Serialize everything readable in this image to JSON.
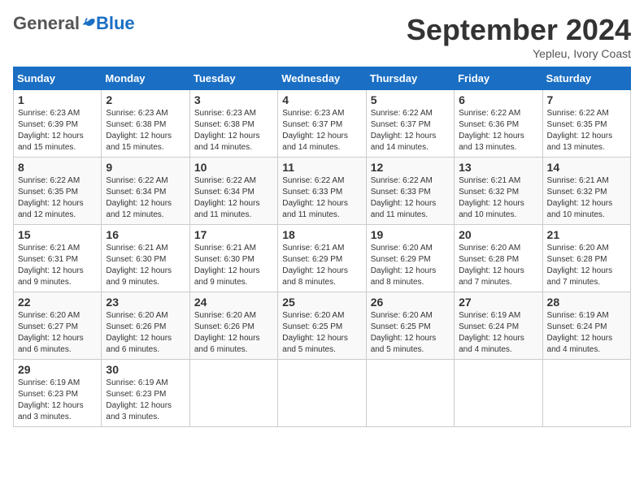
{
  "header": {
    "logo_general": "General",
    "logo_blue": "Blue",
    "month_title": "September 2024",
    "location": "Yepleu, Ivory Coast"
  },
  "calendar": {
    "days_of_week": [
      "Sunday",
      "Monday",
      "Tuesday",
      "Wednesday",
      "Thursday",
      "Friday",
      "Saturday"
    ],
    "weeks": [
      [
        {
          "day": "",
          "sunrise": "",
          "sunset": "",
          "daylight": ""
        },
        {
          "day": "",
          "sunrise": "",
          "sunset": "",
          "daylight": ""
        },
        {
          "day": "",
          "sunrise": "",
          "sunset": "",
          "daylight": ""
        },
        {
          "day": "",
          "sunrise": "",
          "sunset": "",
          "daylight": ""
        },
        {
          "day": "",
          "sunrise": "",
          "sunset": "",
          "daylight": ""
        },
        {
          "day": "",
          "sunrise": "",
          "sunset": "",
          "daylight": ""
        },
        {
          "day": "",
          "sunrise": "",
          "sunset": "",
          "daylight": ""
        }
      ],
      [
        {
          "day": "1",
          "sunrise": "6:23 AM",
          "sunset": "6:39 PM",
          "daylight": "12 hours and 15 minutes."
        },
        {
          "day": "2",
          "sunrise": "6:23 AM",
          "sunset": "6:38 PM",
          "daylight": "12 hours and 15 minutes."
        },
        {
          "day": "3",
          "sunrise": "6:23 AM",
          "sunset": "6:38 PM",
          "daylight": "12 hours and 14 minutes."
        },
        {
          "day": "4",
          "sunrise": "6:23 AM",
          "sunset": "6:37 PM",
          "daylight": "12 hours and 14 minutes."
        },
        {
          "day": "5",
          "sunrise": "6:22 AM",
          "sunset": "6:37 PM",
          "daylight": "12 hours and 14 minutes."
        },
        {
          "day": "6",
          "sunrise": "6:22 AM",
          "sunset": "6:36 PM",
          "daylight": "12 hours and 13 minutes."
        },
        {
          "day": "7",
          "sunrise": "6:22 AM",
          "sunset": "6:35 PM",
          "daylight": "12 hours and 13 minutes."
        }
      ],
      [
        {
          "day": "8",
          "sunrise": "6:22 AM",
          "sunset": "6:35 PM",
          "daylight": "12 hours and 12 minutes."
        },
        {
          "day": "9",
          "sunrise": "6:22 AM",
          "sunset": "6:34 PM",
          "daylight": "12 hours and 12 minutes."
        },
        {
          "day": "10",
          "sunrise": "6:22 AM",
          "sunset": "6:34 PM",
          "daylight": "12 hours and 11 minutes."
        },
        {
          "day": "11",
          "sunrise": "6:22 AM",
          "sunset": "6:33 PM",
          "daylight": "12 hours and 11 minutes."
        },
        {
          "day": "12",
          "sunrise": "6:22 AM",
          "sunset": "6:33 PM",
          "daylight": "12 hours and 11 minutes."
        },
        {
          "day": "13",
          "sunrise": "6:21 AM",
          "sunset": "6:32 PM",
          "daylight": "12 hours and 10 minutes."
        },
        {
          "day": "14",
          "sunrise": "6:21 AM",
          "sunset": "6:32 PM",
          "daylight": "12 hours and 10 minutes."
        }
      ],
      [
        {
          "day": "15",
          "sunrise": "6:21 AM",
          "sunset": "6:31 PM",
          "daylight": "12 hours and 9 minutes."
        },
        {
          "day": "16",
          "sunrise": "6:21 AM",
          "sunset": "6:30 PM",
          "daylight": "12 hours and 9 minutes."
        },
        {
          "day": "17",
          "sunrise": "6:21 AM",
          "sunset": "6:30 PM",
          "daylight": "12 hours and 9 minutes."
        },
        {
          "day": "18",
          "sunrise": "6:21 AM",
          "sunset": "6:29 PM",
          "daylight": "12 hours and 8 minutes."
        },
        {
          "day": "19",
          "sunrise": "6:20 AM",
          "sunset": "6:29 PM",
          "daylight": "12 hours and 8 minutes."
        },
        {
          "day": "20",
          "sunrise": "6:20 AM",
          "sunset": "6:28 PM",
          "daylight": "12 hours and 7 minutes."
        },
        {
          "day": "21",
          "sunrise": "6:20 AM",
          "sunset": "6:28 PM",
          "daylight": "12 hours and 7 minutes."
        }
      ],
      [
        {
          "day": "22",
          "sunrise": "6:20 AM",
          "sunset": "6:27 PM",
          "daylight": "12 hours and 6 minutes."
        },
        {
          "day": "23",
          "sunrise": "6:20 AM",
          "sunset": "6:26 PM",
          "daylight": "12 hours and 6 minutes."
        },
        {
          "day": "24",
          "sunrise": "6:20 AM",
          "sunset": "6:26 PM",
          "daylight": "12 hours and 6 minutes."
        },
        {
          "day": "25",
          "sunrise": "6:20 AM",
          "sunset": "6:25 PM",
          "daylight": "12 hours and 5 minutes."
        },
        {
          "day": "26",
          "sunrise": "6:20 AM",
          "sunset": "6:25 PM",
          "daylight": "12 hours and 5 minutes."
        },
        {
          "day": "27",
          "sunrise": "6:19 AM",
          "sunset": "6:24 PM",
          "daylight": "12 hours and 4 minutes."
        },
        {
          "day": "28",
          "sunrise": "6:19 AM",
          "sunset": "6:24 PM",
          "daylight": "12 hours and 4 minutes."
        }
      ],
      [
        {
          "day": "29",
          "sunrise": "6:19 AM",
          "sunset": "6:23 PM",
          "daylight": "12 hours and 3 minutes."
        },
        {
          "day": "30",
          "sunrise": "6:19 AM",
          "sunset": "6:23 PM",
          "daylight": "12 hours and 3 minutes."
        },
        {
          "day": "",
          "sunrise": "",
          "sunset": "",
          "daylight": ""
        },
        {
          "day": "",
          "sunrise": "",
          "sunset": "",
          "daylight": ""
        },
        {
          "day": "",
          "sunrise": "",
          "sunset": "",
          "daylight": ""
        },
        {
          "day": "",
          "sunrise": "",
          "sunset": "",
          "daylight": ""
        },
        {
          "day": "",
          "sunrise": "",
          "sunset": "",
          "daylight": ""
        }
      ]
    ]
  }
}
